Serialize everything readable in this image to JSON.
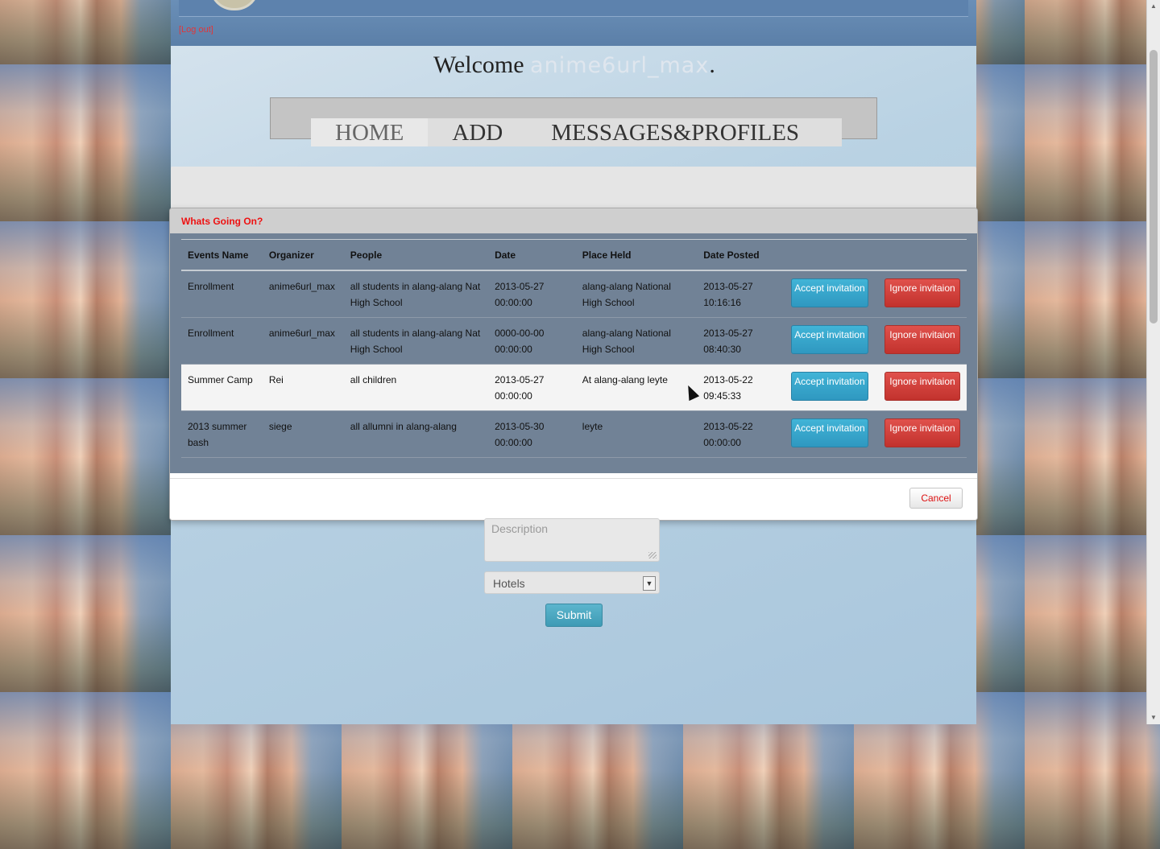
{
  "header": {
    "logout_label": "[Log out]",
    "welcome_text": "Welcome ",
    "username": "anime6url_max",
    "welcome_suffix": "."
  },
  "nav": {
    "items": [
      {
        "label": "HOME"
      },
      {
        "label": "ADD"
      },
      {
        "label": "MESSAGES&PROFILES"
      }
    ]
  },
  "modal": {
    "title": "Whats Going On?",
    "columns": [
      "Events Name",
      "Organizer",
      "People",
      "Date",
      "Place Held",
      "Date Posted"
    ],
    "rows": [
      {
        "event": "Enrollment",
        "organizer": "anime6url_max",
        "people": "all students in alang-alang Nat High School",
        "date": "2013-05-27 00:00:00",
        "place": "alang-alang National High School",
        "posted": "2013-05-27 10:16:16"
      },
      {
        "event": "Enrollment",
        "organizer": "anime6url_max",
        "people": "all students in alang-alang Nat High School",
        "date": "0000-00-00 00:00:00",
        "place": "alang-alang National High School",
        "posted": "2013-05-27 08:40:30"
      },
      {
        "event": "Summer Camp",
        "organizer": "Rei",
        "people": "all children",
        "date": "2013-05-27 00:00:00",
        "place": "At alang-alang leyte",
        "posted": "2013-05-22 09:45:33"
      },
      {
        "event": "2013 summer bash",
        "organizer": "siege",
        "people": "all allumni in alang-alang",
        "date": "2013-05-30 00:00:00",
        "place": "leyte",
        "posted": "2013-05-22 00:00:00"
      }
    ],
    "accept_label": "Accept invitation",
    "ignore_label": "Ignore invitaion",
    "cancel_label": "Cancel"
  },
  "form": {
    "description_placeholder": "Description",
    "category_selected": "Hotels",
    "submit_label": "Submit"
  },
  "colors": {
    "accent_red": "#e11111",
    "accept_blue": "#2f98c0",
    "ignore_red": "#c2322d",
    "modal_body": "#718296"
  }
}
